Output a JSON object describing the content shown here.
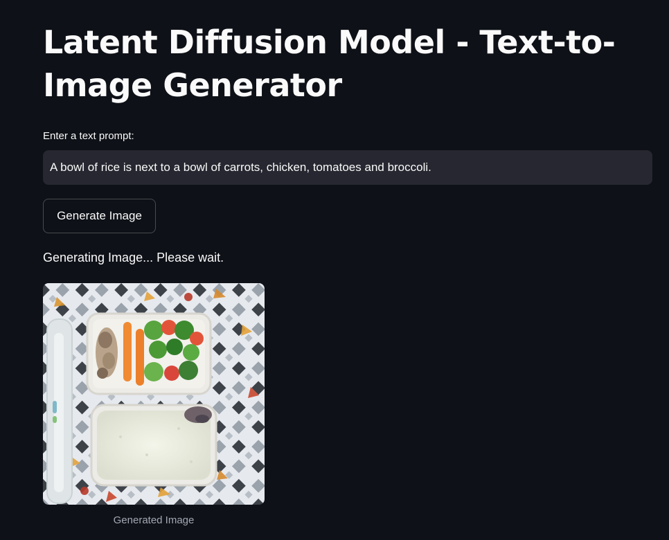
{
  "page": {
    "title": "Latent Diffusion Model - Text-to-Image Generator"
  },
  "prompt": {
    "label": "Enter a text prompt:",
    "value": "A bowl of rice is next to a bowl of carrots, chicken, tomatoes and broccoli."
  },
  "generate_button": {
    "label": "Generate Image"
  },
  "status": {
    "text": "Generating Image... Please wait."
  },
  "result": {
    "caption": "Generated Image"
  },
  "colors": {
    "background": "#0e1117",
    "input_background": "#262730",
    "text": "#fafafa",
    "caption_text": "#a3a8b4"
  }
}
